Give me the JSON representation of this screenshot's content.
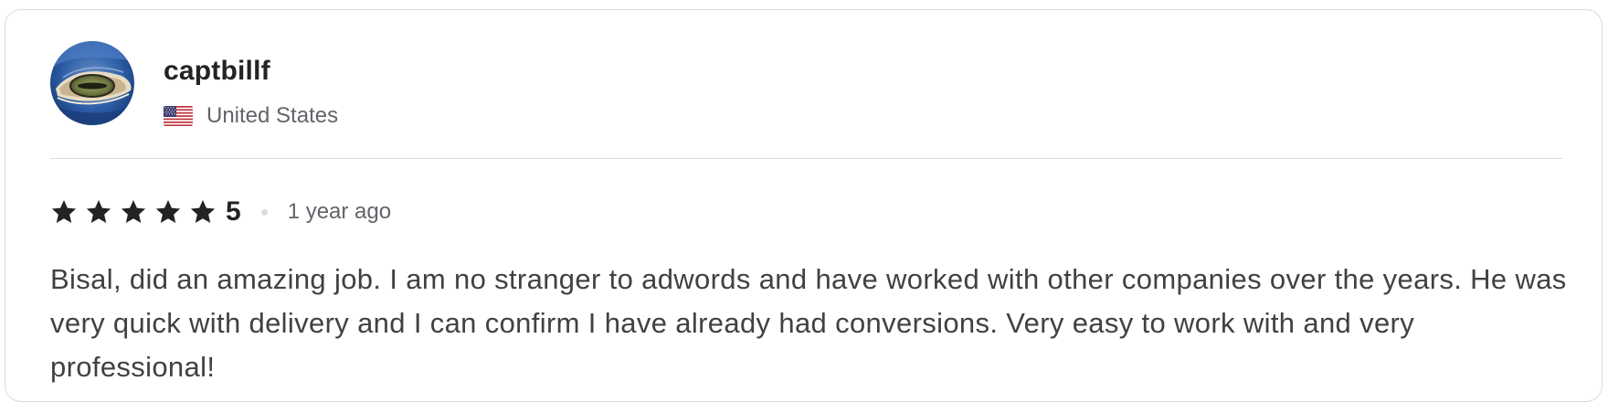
{
  "review": {
    "username": "captbillf",
    "country": "United States",
    "country_flag_icon": "us-flag-icon",
    "avatar_icon": "alligator-eye-avatar",
    "rating": "5",
    "stars_filled": 5,
    "stars_total": 5,
    "star_color": "#222325",
    "time_ago": "1 year ago",
    "body": "Bisal, did an amazing job. I am no stranger to adwords and have worked with other companies over the years. He was very quick with delivery and I can confirm I have already had conversions. Very easy to work with and very professional!"
  }
}
